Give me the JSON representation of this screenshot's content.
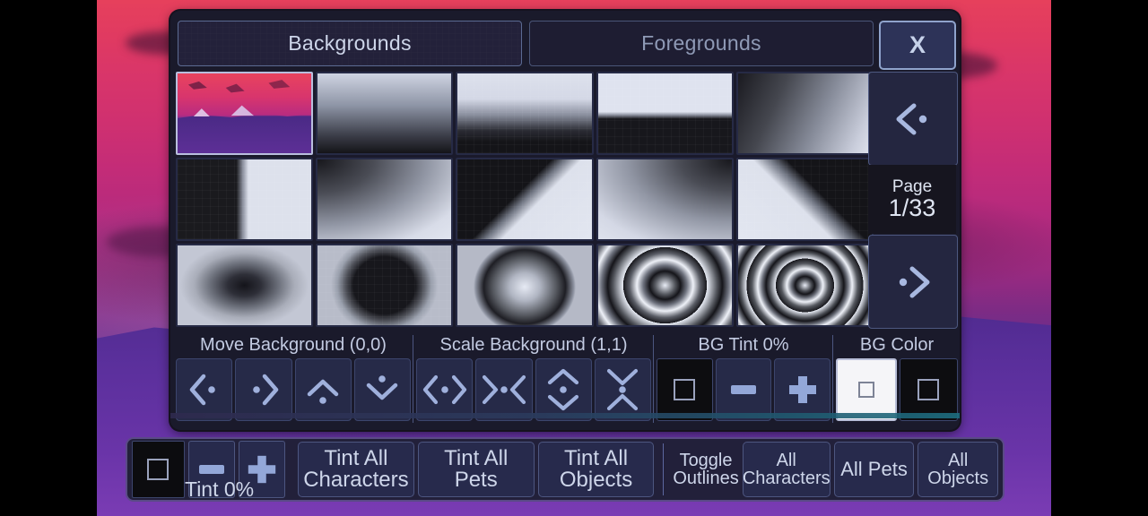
{
  "tabs": [
    {
      "label": "Backgrounds",
      "active": true
    },
    {
      "label": "Foregrounds",
      "active": false
    }
  ],
  "close_label": "X",
  "pager": {
    "prev_icon": "chevron-left-dot-icon",
    "next_icon": "chevron-right-dot-icon",
    "page_label": "Page",
    "page_value": "1/33"
  },
  "thumbnails": [
    {
      "name": "scenic-sunset-mountains",
      "selected": true
    },
    {
      "name": "vertical-gradient-light-top",
      "selected": false
    },
    {
      "name": "vertical-gradient-sharp",
      "selected": false
    },
    {
      "name": "horizon-split",
      "selected": false
    },
    {
      "name": "diagonal-gradient-dark-left",
      "selected": false
    },
    {
      "name": "vertical-split-half",
      "selected": false
    },
    {
      "name": "corner-gradient-dark-topleft",
      "selected": false
    },
    {
      "name": "diagonal-wedge-dark-top",
      "selected": false
    },
    {
      "name": "corner-gradient-dark-topright",
      "selected": false
    },
    {
      "name": "diagonal-wedge-dark-right",
      "selected": false
    },
    {
      "name": "radial-dark-center-soft",
      "selected": false
    },
    {
      "name": "radial-dark-ellipse",
      "selected": false
    },
    {
      "name": "radial-light-center",
      "selected": false
    },
    {
      "name": "concentric-rings-two",
      "selected": false
    },
    {
      "name": "concentric-rings-three",
      "selected": false
    }
  ],
  "controls": {
    "move": {
      "title": "Move Background (0,0)",
      "buttons": [
        {
          "name": "move-left-button",
          "icon": "chevron-left-dot-icon"
        },
        {
          "name": "move-right-button",
          "icon": "chevron-right-dot-icon"
        },
        {
          "name": "move-up-button",
          "icon": "chevron-up-dot-icon"
        },
        {
          "name": "move-down-button",
          "icon": "chevron-down-dot-icon"
        }
      ]
    },
    "scale": {
      "title": "Scale Background (1,1)",
      "buttons": [
        {
          "name": "scale-expand-horizontal-button",
          "icon": "expand-horizontal-icon"
        },
        {
          "name": "scale-shrink-horizontal-button",
          "icon": "shrink-horizontal-icon"
        },
        {
          "name": "scale-expand-vertical-button",
          "icon": "expand-vertical-icon"
        },
        {
          "name": "scale-shrink-vertical-button",
          "icon": "shrink-vertical-icon"
        }
      ]
    },
    "bg_tint": {
      "title": "BG Tint 0%",
      "swatch_color": "#0d0d10",
      "minus_label": "-",
      "plus_label": "+"
    },
    "bg_color": {
      "title": "BG Color",
      "swatches": [
        {
          "name": "bg-color-white-swatch",
          "color": "#f5f5f8",
          "selected": true
        },
        {
          "name": "bg-color-black-swatch",
          "color": "#0d0d10",
          "selected": false
        }
      ]
    }
  },
  "toolbar": {
    "tint_swatch_color": "#0c0c0f",
    "tint_minus_label": "-",
    "tint_plus_label": "+",
    "tint_label": "Tint 0%",
    "buttons": [
      {
        "name": "tint-all-characters-button",
        "line1": "Tint All",
        "line2": "Characters"
      },
      {
        "name": "tint-all-pets-button",
        "line1": "Tint All",
        "line2": "Pets"
      },
      {
        "name": "tint-all-objects-button",
        "line1": "Tint All",
        "line2": "Objects"
      }
    ],
    "outlines_label": {
      "line1": "Toggle",
      "line2": "Outlines"
    },
    "outline_buttons": [
      {
        "name": "outline-all-characters-button",
        "line1": "All",
        "line2": "Characters"
      },
      {
        "name": "outline-all-pets-button",
        "line1": "All Pets",
        "line2": ""
      },
      {
        "name": "outline-all-objects-button",
        "line1": "All",
        "line2": "Objects"
      }
    ]
  },
  "theme": {
    "accent": "#93a7d8",
    "panel_bg": "#1a1a2b",
    "button_bg": "#262a48",
    "text": "#ced6ea"
  }
}
